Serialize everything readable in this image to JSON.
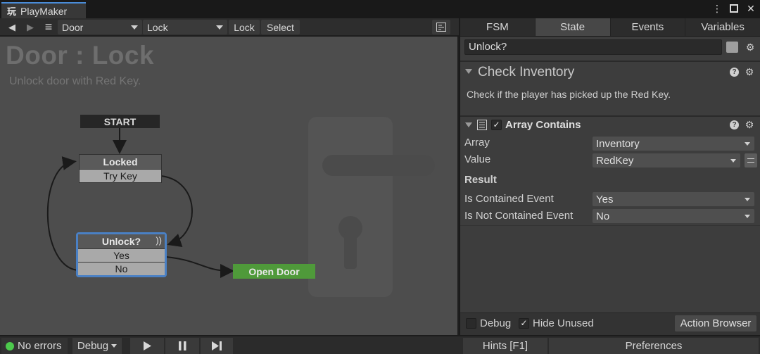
{
  "window": {
    "tab_title": "PlayMaker",
    "tab_logo": "玩"
  },
  "toolbar": {
    "back_glyph": "◀",
    "forward_glyph": "▶",
    "menu_glyph": "≡",
    "gameobject_dropdown": "Door",
    "fsm_dropdown": "Lock",
    "lock_button": "Lock",
    "select_button": "Select"
  },
  "graph": {
    "fsm_title": "Door : Lock",
    "fsm_description": "Unlock door with Red Key.",
    "start_label": "START",
    "states": {
      "locked": {
        "name": "Locked",
        "transitions": [
          "Try Key"
        ]
      },
      "unlock": {
        "name": "Unlock?",
        "transitions": [
          "Yes",
          "No"
        ],
        "selected": true
      },
      "open_door": {
        "name": "Open Door"
      }
    }
  },
  "inspector": {
    "tabs": [
      "FSM",
      "State",
      "Events",
      "Variables"
    ],
    "active_tab": "State",
    "state_name": "Unlock?",
    "state_action": {
      "title": "Check Inventory",
      "description": "Check if the player has picked up the Red Key."
    },
    "action": {
      "title": "Array Contains",
      "enabled": true,
      "fields": {
        "array_label": "Array",
        "array_value": "Inventory",
        "value_label": "Value",
        "value_value": "RedKey",
        "result_header": "Result",
        "contained_label": "Is Contained Event",
        "contained_value": "Yes",
        "not_contained_label": "Is Not Contained Event",
        "not_contained_value": "No"
      }
    },
    "bottom": {
      "debug_label": "Debug",
      "debug_checked": false,
      "hide_unused_label": "Hide Unused",
      "hide_unused_checked": true,
      "action_browser": "Action Browser"
    }
  },
  "status_bar": {
    "errors": "No errors",
    "debug_dropdown": "Debug",
    "hints": "Hints [F1]",
    "preferences": "Preferences"
  },
  "colors": {
    "accent_blue": "#4a8cd8",
    "start_node": "#262626",
    "state_node": "#5a5a5a",
    "open_door_node": "#4f9a3a",
    "status_ok": "#4cc94c"
  }
}
